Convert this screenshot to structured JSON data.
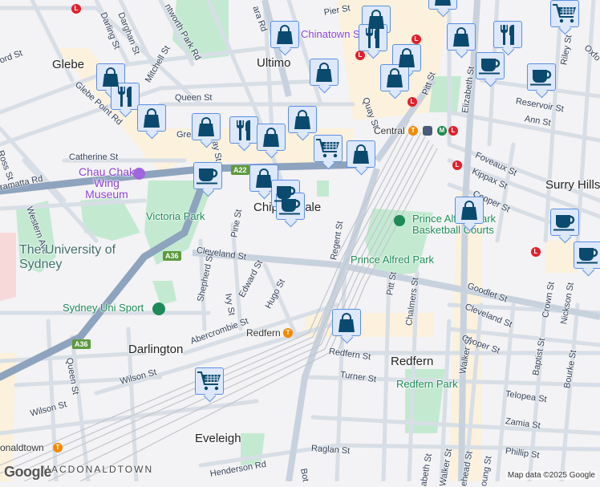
{
  "map": {
    "suburbs": [
      "Glebe",
      "Ultimo",
      "Chippendale",
      "Surry Hills",
      "Darlington",
      "Redfern",
      "Eveleigh"
    ],
    "streets": [
      "Pier St",
      "Darling St",
      "Darghan St",
      "ntworth Park Rd",
      "ara Rd",
      "ord St",
      "Mitchell St",
      "Glebe Point Rd",
      "Queen St",
      "Gre",
      "ay St",
      "Catherine St",
      "Ross St",
      "ramatta Rd",
      "Western Ave",
      "Pine St",
      "Quay St",
      "Pitt St",
      "Elizabeth St",
      "Riley St",
      "Oxfo",
      "Reservoir St",
      "Ann St",
      "Foveaux St",
      "Kippax St",
      "Cooper St",
      "Regent St",
      "Cleveland St",
      "Shepherd St",
      "Ivy St",
      "Edward St",
      "Hugo St",
      "Abercrombie St",
      "Queen St",
      "Wilson St",
      "Wilson St",
      "Henderson Rd",
      "Goodlet St",
      "Cleveland St",
      "Crown St",
      "Nickson St",
      "Pitt St",
      "Chalmers St",
      "Cooper St",
      "Walker St",
      "Baptist St",
      "Bourke St",
      "Redfern St",
      "Turner St",
      "Telopea St",
      "Zamia St",
      "Raglan St",
      "Phillip St",
      "abeth St",
      "Walker St",
      "ehead St",
      "oung St",
      "Bot",
      "MACDONALDTOWN"
    ],
    "parks": [
      "Victoria Park",
      "Prince Alfred Park",
      "Prince Alfred Park Basketball Courts",
      "Sydney Uni Sport",
      "Redfern Park"
    ],
    "poi": {
      "museum": "Chau Chak Wing Museum",
      "chinatown": "Chinatown Sydney",
      "university": "The University of Sydney"
    },
    "stations": {
      "central": "Central",
      "redfern": "Redfern",
      "macdonaldtown": "onaldtown"
    },
    "route_shields": [
      "A22",
      "A36",
      "A36"
    ],
    "transit_badges": {
      "train": "T",
      "metro": "M",
      "light_rail": "L"
    },
    "attribution": "Map data ©2025 Google",
    "logo": "Google"
  },
  "markers": [
    "shopping-bag",
    "shopping-bag",
    "restaurant",
    "shopping-bag",
    "shopping-bag",
    "restaurant",
    "shopping-bag",
    "shopping-bag",
    "cafe",
    "shopping-bag",
    "cafe",
    "cafe",
    "shopping-cart",
    "shopping-bag",
    "shopping-bag",
    "restaurant",
    "shopping-bag",
    "shopping-bag",
    "shopping-bag",
    "shopping-bag",
    "restaurant",
    "cafe",
    "cafe",
    "shopping-cart",
    "shopping-bag",
    "shopping-bag",
    "cafe",
    "cafe",
    "shopping-bag",
    "shopping-cart"
  ],
  "colors": {
    "marker_icon": "#0b4a6f",
    "marker_bg": "#dde8fb",
    "marker_border": "#5b8fe2",
    "park": "#c3ead1",
    "highway": "#8ea3bd",
    "light_rail": "#e0202e",
    "train": "#f28a00",
    "metro": "#1b8a4c"
  }
}
